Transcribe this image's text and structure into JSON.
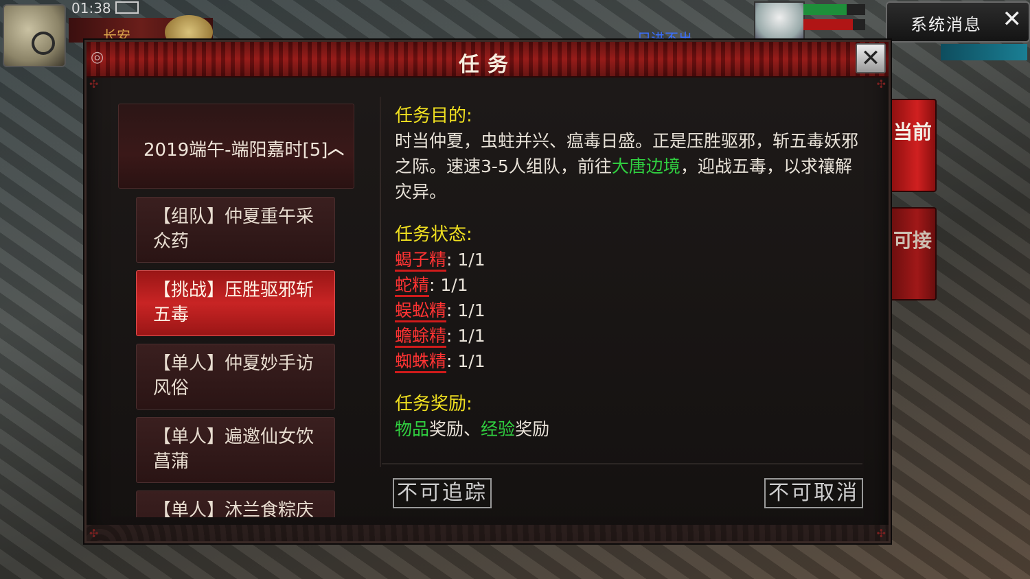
{
  "hud": {
    "time": "01:38",
    "location": "长安",
    "scene_text": "只进不出",
    "system_message_label": "系统消息",
    "close_glyph": "✕"
  },
  "side_tabs": [
    {
      "label": "当前",
      "active": true
    },
    {
      "label": "可接",
      "active": false
    }
  ],
  "dialog": {
    "title": "任务",
    "close_glyph": "✕",
    "category": {
      "label": "2019端午-端阳嘉时[5]",
      "expanded_glyph": "︿"
    },
    "quests": [
      {
        "label": "【组队】仲夏重午采众药",
        "selected": false
      },
      {
        "label": "【挑战】压胜驱邪斩五毒",
        "selected": true
      },
      {
        "label": "【单人】仲夏妙手访风俗",
        "selected": false
      },
      {
        "label": "【单人】遍邀仙女饮菖蒲",
        "selected": false
      },
      {
        "label": "【单人】沐兰食粽庆",
        "selected": false
      }
    ],
    "detail": {
      "objective_heading": "任务目的:",
      "objective_part1": "时当仲夏，虫蛀并兴、瘟毒日盛。正是压胜驱邪，斩五毒妖邪之际。速速3-5人组队，前往",
      "objective_location": "大唐边境",
      "objective_part2": "，迎战五毒，以求禳解灾异。",
      "status_heading": "任务状态:",
      "status_items": [
        {
          "name": "蝎子精",
          "progress": ": 1/1"
        },
        {
          "name": "蛇精",
          "progress": ": 1/1"
        },
        {
          "name": "蜈蚣精",
          "progress": ": 1/1"
        },
        {
          "name": "蟾蜍精",
          "progress": ": 1/1"
        },
        {
          "name": "蜘蛛精",
          "progress": ": 1/1"
        }
      ],
      "reward_heading": "任务奖励:",
      "reward_item_link": "物品",
      "reward_item_suffix": "奖励",
      "reward_sep": "、",
      "reward_exp_link": "经验",
      "reward_exp_suffix": "奖励"
    },
    "actions": {
      "track_label": "不可追踪",
      "cancel_label": "不可取消"
    }
  },
  "colors": {
    "heading": "#f0e020",
    "link_green": "#30d040",
    "target_red": "#ff3333",
    "selected_quest": "#c82424"
  }
}
